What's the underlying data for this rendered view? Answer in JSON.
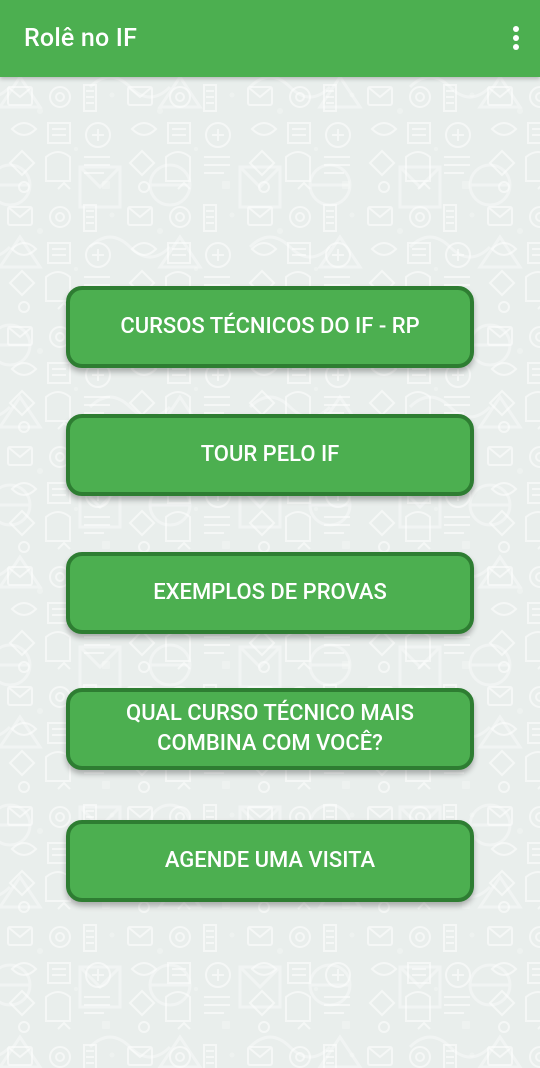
{
  "app_bar": {
    "title": "Rolê no IF",
    "menu_icon": "more-vert-icon",
    "color": "#4caf50"
  },
  "background": {
    "color": "#e9eeec",
    "pattern_color": "#ffffff"
  },
  "buttons": [
    {
      "label": "CURSOS TÉCNICOS DO IF - RP"
    },
    {
      "label": "TOUR PELO IF"
    },
    {
      "label": "EXEMPLOS DE PROVAS"
    },
    {
      "label": "QUAL CURSO TÉCNICO MAIS COMBINA COM VOCÊ?"
    },
    {
      "label": "AGENDE UMA VISITA"
    }
  ],
  "button_style": {
    "fill": "#4caf50",
    "border": "#2e7d32",
    "text_color": "#ffffff"
  }
}
